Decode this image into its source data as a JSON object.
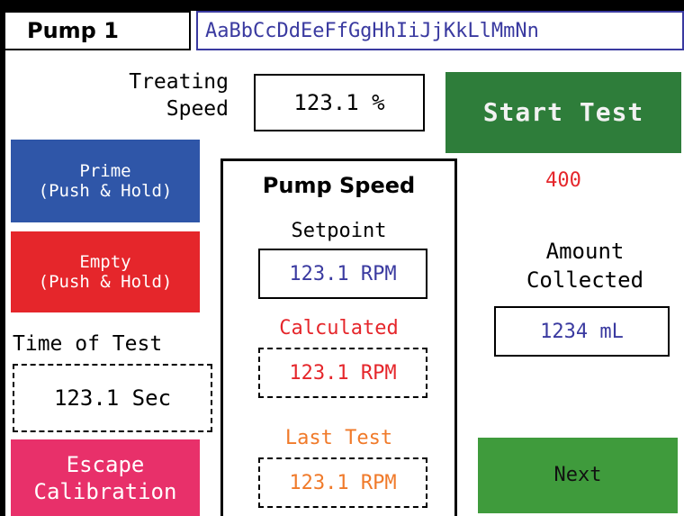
{
  "header": {
    "title": "Pump 1",
    "name_field_value": "AaBbCcDdEeFfGgHhIiJjKkLlMmNn"
  },
  "treating_speed": {
    "label": "Treating\nSpeed",
    "value": "123.1 %"
  },
  "buttons": {
    "start_test": "Start Test",
    "prime": "Prime\n(Push & Hold)",
    "empty": "Empty\n(Push & Hold)",
    "escape": "Escape\nCalibration",
    "next": "Next"
  },
  "counter": "400",
  "amount_collected": {
    "label": "Amount\nCollected",
    "value": "1234 mL"
  },
  "time_of_test": {
    "label": "Time of Test",
    "value": "123.1 Sec"
  },
  "pump_speed": {
    "title": "Pump Speed",
    "setpoint_label": "Setpoint",
    "setpoint_value": "123.1 RPM",
    "calculated_label": "Calculated",
    "calculated_value": "123.1 RPM",
    "last_test_label": "Last Test",
    "last_test_value": "123.1 RPM"
  },
  "colors": {
    "start_button": "#2e7d3a",
    "prime_button": "#2f56a8",
    "empty_button": "#e5262b",
    "escape_button": "#e8306a",
    "next_button": "#3f9b3c",
    "input_text": "#3a3aa0",
    "calculated": "#e5262b",
    "last_test": "#f07a2a"
  }
}
